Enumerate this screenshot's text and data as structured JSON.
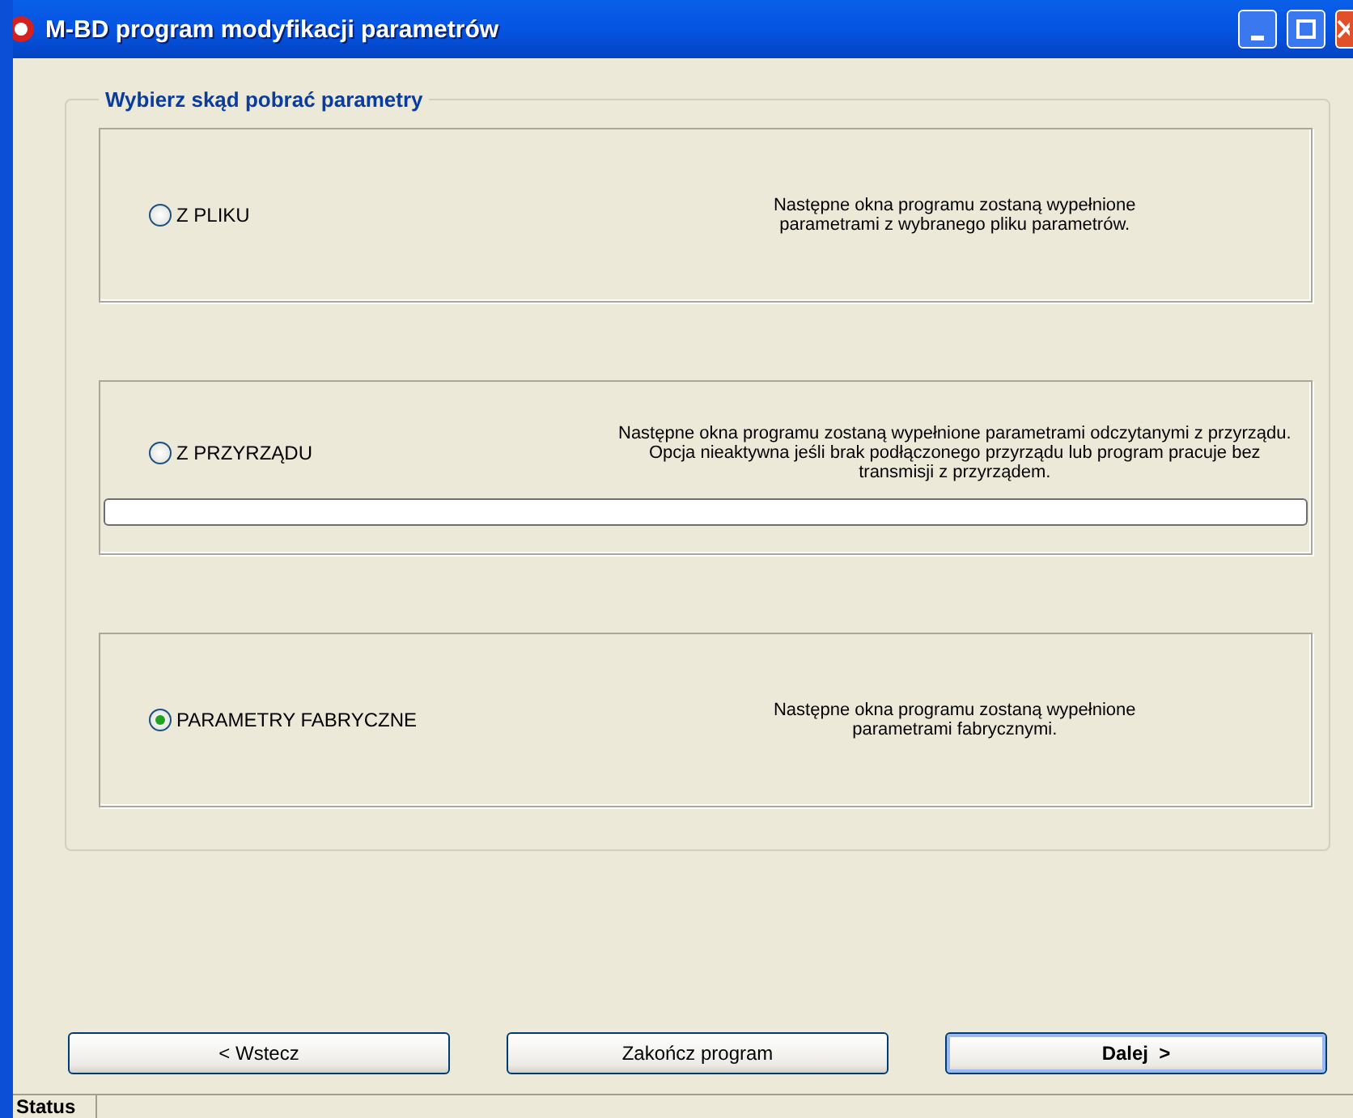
{
  "window": {
    "title": "M-BD program modyfikacji parametrów"
  },
  "group": {
    "title": "Wybierz skąd pobrać parametry"
  },
  "options": [
    {
      "label": "Z PLIKU",
      "selected": false,
      "description": "Następne okna programu zostaną wypełnione\nparametrami z wybranego pliku parametrów."
    },
    {
      "label": "Z PRZYRZĄDU",
      "selected": false,
      "description": "Następne okna programu zostaną wypełnione parametrami odczytanymi z przyrządu.\nOpcja nieaktywna jeśli brak podłączonego przyrządu lub program pracuje bez\ntransmisji z przyrządem.",
      "progress": {
        "level": 0
      }
    },
    {
      "label": "PARAMETRY FABRYCZNE",
      "selected": true,
      "description": "Następne okna programu zostaną wypełnione\nparametrami fabrycznymi."
    }
  ],
  "buttons": [
    {
      "label": "< Wstecz",
      "default": false
    },
    {
      "label": "Zakończ program",
      "default": false
    },
    {
      "label": "Dalej  >",
      "default": true
    }
  ],
  "status_bar": {
    "text": "Status"
  }
}
